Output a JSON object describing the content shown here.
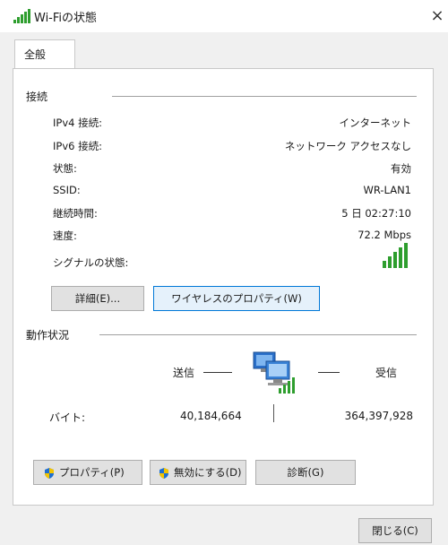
{
  "window": {
    "title": "Wi-Fiの状態",
    "close_glyph": "×"
  },
  "tabs": [
    {
      "label": "全般"
    }
  ],
  "connection": {
    "section_label": "接続",
    "rows": [
      {
        "label": "IPv4 接続:",
        "value": "インターネット"
      },
      {
        "label": "IPv6 接続:",
        "value": "ネットワーク アクセスなし"
      },
      {
        "label": "状態:",
        "value": "有効"
      },
      {
        "label": "SSID:",
        "value": "WR-LAN1"
      },
      {
        "label": "継続時間:",
        "value": "5 日 02:27:10"
      },
      {
        "label": "速度:",
        "value": "72.2 Mbps"
      }
    ],
    "signal_label": "シグナルの状態:",
    "signal_bars": 5,
    "details_button": "詳細(E)...",
    "wireless_props_button": "ワイヤレスのプロパティ(W)"
  },
  "activity": {
    "section_label": "動作状況",
    "sent_label": "送信",
    "received_label": "受信",
    "bytes_label": "バイト:",
    "bytes_sent": "40,184,664",
    "bytes_received": "364,397,928"
  },
  "buttons": {
    "properties": "プロパティ(P)",
    "disable": "無効にする(D)",
    "diagnose": "診断(G)",
    "close": "閉じる(C)"
  },
  "colors": {
    "signal": "#2e9e2e",
    "accent": "#0078d7"
  }
}
